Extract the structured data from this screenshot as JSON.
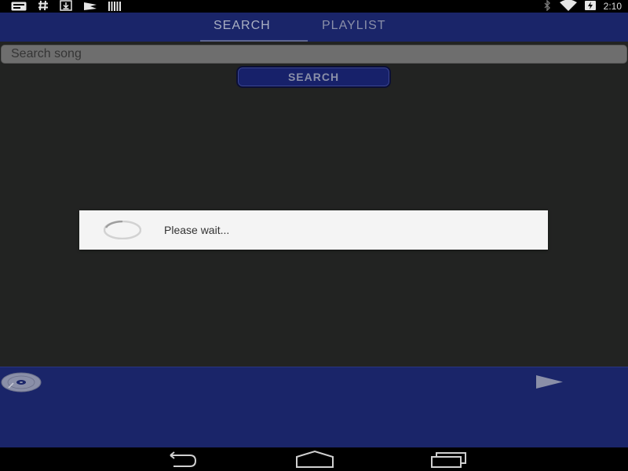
{
  "status_bar": {
    "left_icons": [
      "notification-card-icon",
      "hashtag-icon",
      "download-icon",
      "flag-icon",
      "barcode-icon"
    ],
    "right_icons": [
      "bluetooth-icon",
      "wifi-icon",
      "battery-charging-icon"
    ],
    "time": "2:10"
  },
  "tabs": [
    {
      "label": "SEARCH",
      "selected": true
    },
    {
      "label": "PLAYLIST",
      "selected": false
    }
  ],
  "search": {
    "placeholder": "Search song",
    "value": "",
    "button_label": "SEARCH"
  },
  "dialog": {
    "message": "Please wait...",
    "icon": "loading-spinner-icon"
  },
  "player_bar": {
    "left_icon": "disc-icon",
    "right_icon": "play-icon"
  },
  "nav_bar": {
    "icons": [
      "back-icon",
      "home-icon",
      "recents-icon"
    ]
  },
  "colors": {
    "primary": "#1a2569",
    "background": "#222322",
    "dialog_background": "#f4f4f4",
    "status_bar": "#000000"
  }
}
